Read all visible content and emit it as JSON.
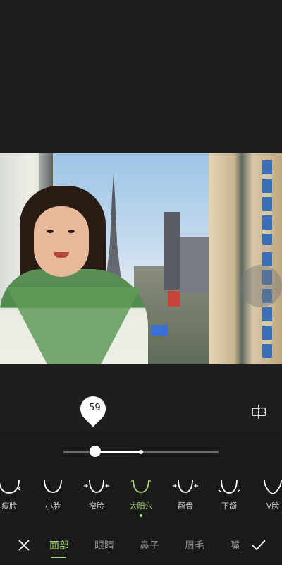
{
  "adjust": {
    "value_label": "-59",
    "level_percent": -59
  },
  "features": [
    {
      "label": "瘦脸"
    },
    {
      "label": "小脸"
    },
    {
      "label": "窄脸"
    },
    {
      "label": "太阳穴"
    },
    {
      "label": "颧骨"
    },
    {
      "label": "下颌"
    },
    {
      "label": "V脸"
    }
  ],
  "tabs": [
    {
      "label": "面部"
    },
    {
      "label": "眼睛"
    },
    {
      "label": "鼻子"
    },
    {
      "label": "眉毛"
    },
    {
      "label": "嘴"
    }
  ],
  "colors": {
    "accent": "#a6d86f",
    "background": "#1e1e1e"
  },
  "icons": {
    "close": "close-icon",
    "confirm": "checkmark-icon",
    "compare": "compare-icon"
  }
}
